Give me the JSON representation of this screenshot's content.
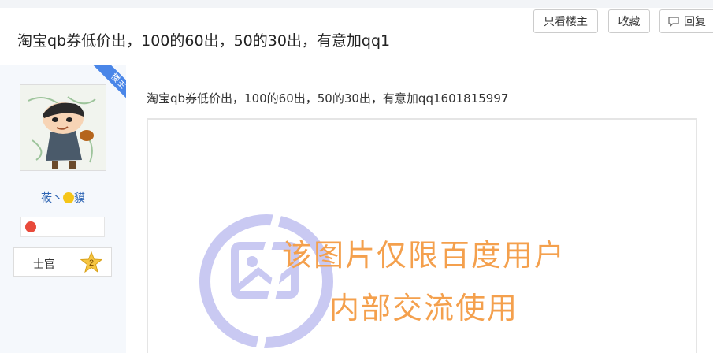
{
  "thread": {
    "title": "淘宝qb券低价出，100的60出，50的30出，有意加qq1",
    "buttons": {
      "author_only": "只看楼主",
      "favorite": "收藏",
      "reply": "回复"
    }
  },
  "author": {
    "ribbon": "楼主",
    "name_part1": "莜丶",
    "name_part2": "貘",
    "rank": "士官",
    "level": "2"
  },
  "post": {
    "text": "淘宝qb券低价出，100的60出，50的30出，有意加qq1601815997",
    "image_notice_line1": "该图片仅限百度用户",
    "image_notice_line2": "内部交流使用"
  }
}
